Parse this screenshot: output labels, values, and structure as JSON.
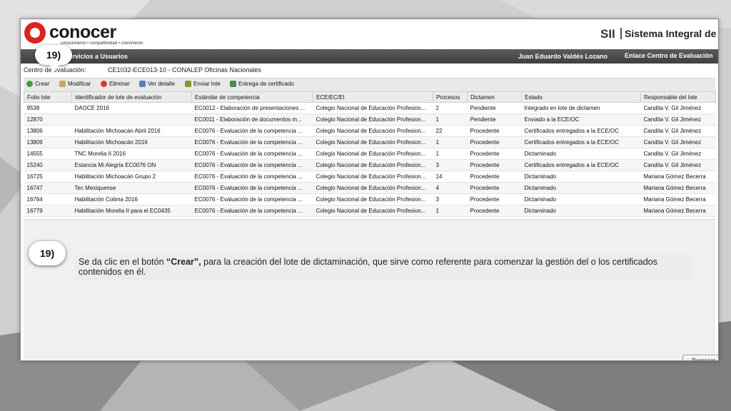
{
  "header": {
    "logo_text": "conocer",
    "logo_tagline": "conocimiento • competitividad • crecimiento",
    "sii_logo": "SII",
    "system_title": "Sistema Integral de In"
  },
  "navbar": {
    "section": "y Servicios a Usuarios",
    "user": "Juan Eduardo Valdés Lozano",
    "role": "Enlace Centro de Evaluación"
  },
  "callouts": {
    "top": "19)",
    "middle": "19)"
  },
  "centro": {
    "label": "Centro de evaluación:",
    "value": "CE1032-ECE013-10 - CONALEP Oficinas Nacionales"
  },
  "toolbar": {
    "crear": "Crear",
    "modificar": "Modificar",
    "eliminar": "Eliminar",
    "ver_detalle": "Ver detalle",
    "enviar_lote": "Enviar lote",
    "entrega": "Entrega de certificado"
  },
  "table": {
    "columns": [
      "Folio lote",
      "Identificador de lote de evaluación",
      "Estándar de competencia",
      "ECE/EC/EI",
      "Procesos",
      "Dictamen",
      "Estado",
      "Responsable del lote"
    ],
    "rows": [
      [
        "9538",
        "DAOCE 2016",
        "EC0012 - Elaboración de presentaciones ...",
        "Colegio Nacional de Educación Profesion...",
        "2",
        "Pendiente",
        "Integrado en lote de dictamen",
        "Candita V. Gil Jiménez"
      ],
      [
        "12870",
        "",
        "EC0011 - Elaboración de documentos m...",
        "Colegio Nacional de Educación Profesion...",
        "1",
        "Pendiente",
        "Enviado a la ECE/OC",
        "Candita V. Gil Jiménez"
      ],
      [
        "13806",
        "Habilitación Michoacán Abril 2016",
        "EC0076 - Evaluación de la competencia ...",
        "Colegio Nacional de Educación Profesion...",
        "22",
        "Procedente",
        "Certificados entregados a la ECE/OC",
        "Candita V. Gil Jiménez"
      ],
      [
        "13809",
        "Habilitación Michoacán 2016",
        "EC0076 - Evaluación de la competencia ...",
        "Colegio Nacional de Educación Profesion...",
        "1",
        "Procedente",
        "Certificados entregados a la ECE/OC",
        "Candita V. Gil Jiménez"
      ],
      [
        "14555",
        "TNC Morelia II 2016",
        "EC0076 - Evaluación de la competencia ...",
        "Colegio Nacional de Educación Profesion...",
        "1",
        "Procedente",
        "Dictaminado",
        "Candita V. Gil Jiménez"
      ],
      [
        "15240",
        "Estancia Mi Alegría EC0076 ON",
        "EC0076 - Evaluación de la competencia ...",
        "Colegio Nacional de Educación Profesion...",
        "3",
        "Procedente",
        "Certificados entregados a la ECE/OC",
        "Candita V. Gil Jiménez"
      ],
      [
        "16725",
        "Habilitación Michoacán Grupo 2",
        "EC0076 - Evaluación de la competencia ...",
        "Colegio Nacional de Educación Profesion...",
        "14",
        "Procedente",
        "Dictaminado",
        "Mariana Gómez Becerra"
      ],
      [
        "16747",
        "Tec Mexiquense",
        "EC0076 - Evaluación de la competencia ...",
        "Colegio Nacional de Educación Profesion...",
        "4",
        "Procedente",
        "Dictaminado",
        "Mariana Gómez Becerra"
      ],
      [
        "16764",
        "Habilitación Colima 2016",
        "EC0076 - Evaluación de la competencia ...",
        "Colegio Nacional de Educación Profesion...",
        "3",
        "Procedente",
        "Dictaminado",
        "Mariana Gómez Becerra"
      ],
      [
        "16779",
        "Habilitación Morelia II para el EC0435",
        "EC0076 - Evaluación de la competencia ...",
        "Colegio Nacional de Educación Profesion...",
        "1",
        "Procedente",
        "Dictaminado",
        "Mariana Gómez Becerra"
      ]
    ]
  },
  "note": {
    "prefix": "Se da clic en el botón ",
    "emphasis": "“Crear”,",
    "suffix": " para la creación del lote de dictaminación, que sirve como referente para comenzar la gestión del o los certificados contenidos en él."
  },
  "buttons": {
    "regresar": "Regresar"
  }
}
